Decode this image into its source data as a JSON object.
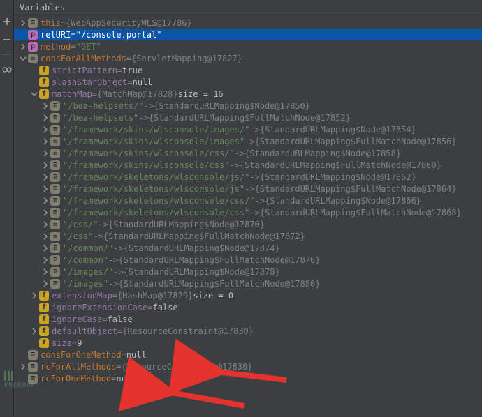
{
  "tab_title": "Variables",
  "icons": {
    "plus": "plus-icon",
    "minus": "minus-icon",
    "glasses": "watch-icon"
  },
  "watermark": "FREEBUF",
  "tree": [
    {
      "depth": 0,
      "exp": "right",
      "badge": "bar",
      "name": "this",
      "eq": " = ",
      "vstyle": "gray",
      "value": "{WebAppSecurityWLS@17786}",
      "int": "true",
      "nstyle": "name"
    },
    {
      "depth": 0,
      "exp": "none",
      "badge": "p",
      "name": "relURI",
      "eq": " = ",
      "vstyle": "str",
      "value": "\"/console.portal\"",
      "int": "true",
      "selected": true,
      "nstyle": "name"
    },
    {
      "depth": 0,
      "exp": "right",
      "badge": "p",
      "name": "method",
      "eq": " = ",
      "vstyle": "str",
      "value": "\"GET\"",
      "int": "true",
      "nstyle": "name"
    },
    {
      "depth": 0,
      "exp": "down",
      "badge": "bar",
      "name": "consForAllMethods",
      "eq": " = ",
      "vstyle": "gray",
      "value": "{ServletMapping@17827}",
      "int": "true",
      "nstyle": "name"
    },
    {
      "depth": 1,
      "exp": "none",
      "badge": "f",
      "name": "strictPattern",
      "eq": " = ",
      "vstyle": "plain",
      "value": "true",
      "int": "true",
      "nstyle": "name-prop"
    },
    {
      "depth": 1,
      "exp": "none",
      "badge": "f",
      "name": "slashStarObject",
      "eq": " = ",
      "vstyle": "plain",
      "value": "null",
      "int": "true",
      "nstyle": "name-prop"
    },
    {
      "depth": 1,
      "exp": "down",
      "badge": "f",
      "name": "matchMap",
      "eq": " = ",
      "vstyle": "gray",
      "value": "{MatchMap@17828}",
      "extra": "  size = 16",
      "int": "true",
      "nstyle": "name-prop"
    },
    {
      "depth": 2,
      "exp": "right",
      "badge": "bar",
      "name": "\"/bea-helpsets/\"",
      "eq": " -> ",
      "vstyle": "gray",
      "value": "{StandardURLMapping$Node@17850}",
      "int": "true",
      "nstyle": "value-str"
    },
    {
      "depth": 2,
      "exp": "right",
      "badge": "bar",
      "name": "\"/bea-helpsets\"",
      "eq": " -> ",
      "vstyle": "gray",
      "value": "{StandardURLMapping$FullMatchNode@17852}",
      "int": "true",
      "nstyle": "value-str"
    },
    {
      "depth": 2,
      "exp": "right",
      "badge": "bar",
      "name": "\"/framework/skins/wlsconsole/images/\"",
      "eq": " -> ",
      "vstyle": "gray",
      "value": "{StandardURLMapping$Node@17854}",
      "int": "true",
      "nstyle": "value-str"
    },
    {
      "depth": 2,
      "exp": "right",
      "badge": "bar",
      "name": "\"/framework/skins/wlsconsole/images\"",
      "eq": " -> ",
      "vstyle": "gray",
      "value": "{StandardURLMapping$FullMatchNode@17856}",
      "int": "true",
      "nstyle": "value-str"
    },
    {
      "depth": 2,
      "exp": "right",
      "badge": "bar",
      "name": "\"/framework/skins/wlsconsole/css/\"",
      "eq": " -> ",
      "vstyle": "gray",
      "value": "{StandardURLMapping$Node@17858}",
      "int": "true",
      "nstyle": "value-str"
    },
    {
      "depth": 2,
      "exp": "right",
      "badge": "bar",
      "name": "\"/framework/skins/wlsconsole/css\"",
      "eq": " -> ",
      "vstyle": "gray",
      "value": "{StandardURLMapping$FullMatchNode@17860}",
      "int": "true",
      "nstyle": "value-str"
    },
    {
      "depth": 2,
      "exp": "right",
      "badge": "bar",
      "name": "\"/framework/skeletons/wlsconsole/js/\"",
      "eq": " -> ",
      "vstyle": "gray",
      "value": "{StandardURLMapping$Node@17862}",
      "int": "true",
      "nstyle": "value-str"
    },
    {
      "depth": 2,
      "exp": "right",
      "badge": "bar",
      "name": "\"/framework/skeletons/wlsconsole/js\"",
      "eq": " -> ",
      "vstyle": "gray",
      "value": "{StandardURLMapping$FullMatchNode@17864}",
      "int": "true",
      "nstyle": "value-str"
    },
    {
      "depth": 2,
      "exp": "right",
      "badge": "bar",
      "name": "\"/framework/skeletons/wlsconsole/css/\"",
      "eq": " -> ",
      "vstyle": "gray",
      "value": "{StandardURLMapping$Node@17866}",
      "int": "true",
      "nstyle": "value-str"
    },
    {
      "depth": 2,
      "exp": "right",
      "badge": "bar",
      "name": "\"/framework/skeletons/wlsconsole/css\"",
      "eq": " -> ",
      "vstyle": "gray",
      "value": "{StandardURLMapping$FullMatchNode@17868}",
      "int": "true",
      "nstyle": "value-str"
    },
    {
      "depth": 2,
      "exp": "right",
      "badge": "bar",
      "name": "\"/css/\"",
      "eq": " -> ",
      "vstyle": "gray",
      "value": "{StandardURLMapping$Node@17870}",
      "int": "true",
      "nstyle": "value-str"
    },
    {
      "depth": 2,
      "exp": "right",
      "badge": "bar",
      "name": "\"/css\"",
      "eq": " -> ",
      "vstyle": "gray",
      "value": "{StandardURLMapping$FullMatchNode@17872}",
      "int": "true",
      "nstyle": "value-str"
    },
    {
      "depth": 2,
      "exp": "right",
      "badge": "bar",
      "name": "\"/common/\"",
      "eq": " -> ",
      "vstyle": "gray",
      "value": "{StandardURLMapping$Node@17874}",
      "int": "true",
      "nstyle": "value-str"
    },
    {
      "depth": 2,
      "exp": "right",
      "badge": "bar",
      "name": "\"/common\"",
      "eq": " -> ",
      "vstyle": "gray",
      "value": "{StandardURLMapping$FullMatchNode@17876}",
      "int": "true",
      "nstyle": "value-str"
    },
    {
      "depth": 2,
      "exp": "right",
      "badge": "bar",
      "name": "\"/images/\"",
      "eq": " -> ",
      "vstyle": "gray",
      "value": "{StandardURLMapping$Node@17878}",
      "int": "true",
      "nstyle": "value-str"
    },
    {
      "depth": 2,
      "exp": "right",
      "badge": "bar",
      "name": "\"/images\"",
      "eq": " -> ",
      "vstyle": "gray",
      "value": "{StandardURLMapping$FullMatchNode@17880}",
      "int": "true",
      "nstyle": "value-str"
    },
    {
      "depth": 1,
      "exp": "right",
      "badge": "f",
      "name": "extensionMap",
      "eq": " = ",
      "vstyle": "gray",
      "value": "{HashMap@17829}",
      "extra": "  size = 0",
      "int": "true",
      "nstyle": "name-prop"
    },
    {
      "depth": 1,
      "exp": "none",
      "badge": "f",
      "name": "ignoreExtensionCase",
      "eq": " = ",
      "vstyle": "plain",
      "value": "false",
      "int": "true",
      "nstyle": "name-prop"
    },
    {
      "depth": 1,
      "exp": "none",
      "badge": "f",
      "name": "ignoreCase",
      "eq": " = ",
      "vstyle": "plain",
      "value": "false",
      "int": "true",
      "nstyle": "name-prop"
    },
    {
      "depth": 1,
      "exp": "right",
      "badge": "f",
      "name": "defaultObject",
      "eq": " = ",
      "vstyle": "gray",
      "value": "{ResourceConstraint@17830}",
      "int": "true",
      "nstyle": "name-prop"
    },
    {
      "depth": 1,
      "exp": "none",
      "badge": "f",
      "name": "size",
      "eq": " = ",
      "vstyle": "plain",
      "value": "9",
      "int": "true",
      "nstyle": "name-prop"
    },
    {
      "depth": 0,
      "exp": "none",
      "badge": "bar",
      "name": "consForOneMethod",
      "eq": " = ",
      "vstyle": "plain",
      "value": "null",
      "int": "true",
      "nstyle": "name"
    },
    {
      "depth": 0,
      "exp": "right",
      "badge": "bar",
      "name": "rcForAllMethods",
      "eq": " = ",
      "vstyle": "gray",
      "value": "{ResourceConstraint@17830}",
      "int": "true",
      "nstyle": "name"
    },
    {
      "depth": 0,
      "exp": "none",
      "badge": "bar",
      "name": "rcForOneMethod",
      "eq": " = ",
      "vstyle": "plain",
      "value": "null",
      "int": "true",
      "nstyle": "name"
    }
  ],
  "annotations": {
    "arrow1": {
      "target": "rcForAllMethods"
    },
    "arrow2": {
      "target": "rcForOneMethod"
    }
  }
}
